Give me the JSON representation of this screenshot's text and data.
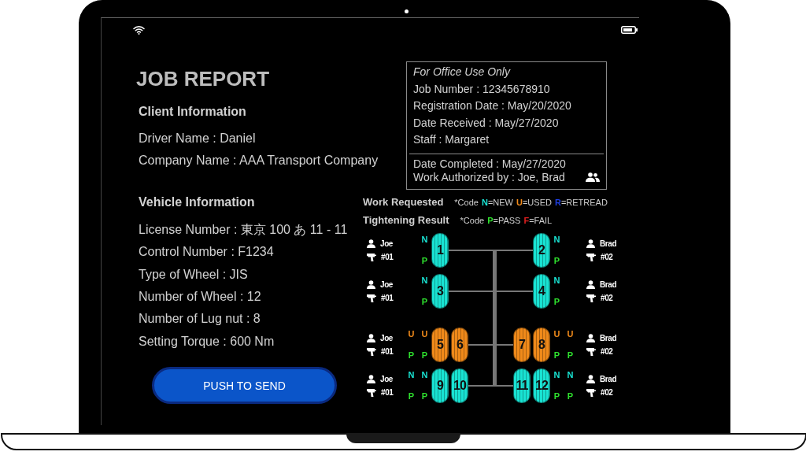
{
  "title": "JOB REPORT",
  "client_information": {
    "heading": "Client Information",
    "fields": [
      "Driver Name : Daniel",
      "Company Name : AAA Transport Company"
    ]
  },
  "vehicle_information": {
    "heading": "Vehicle Information",
    "fields": [
      "License Number : 東京 100 あ 11 - 11",
      "Control Number : F1234",
      "Type of Wheel : JIS",
      "Number of Wheel : 12",
      "Number of Lug nut : 8",
      "Setting Torque : 600 Nm"
    ]
  },
  "send_button": "PUSH TO SEND",
  "office_use": {
    "heading": "For Office Use Only",
    "fields": [
      "Job Number : 12345678910",
      "Registration Date : May/20/2020",
      "Date Received : May/27/2020",
      "Staff : Margaret"
    ],
    "completion_fields": [
      "Date Completed : May/27/2020",
      "Work Authorized by : Joe, Brad"
    ]
  },
  "work_requested": {
    "title": "Work Requested",
    "code_prefix": "*Code",
    "codes": [
      {
        "code": "N",
        "meaning": "=NEW",
        "color": "#19e3d3"
      },
      {
        "code": "U",
        "meaning": "=USED",
        "color": "#f08a1a"
      },
      {
        "code": "R",
        "meaning": "=RETREAD",
        "color": "#1f3fe0"
      }
    ]
  },
  "tightening_result": {
    "title": "Tightening Result",
    "code_prefix": "*Code",
    "codes": [
      {
        "code": "P",
        "meaning": "=PASS",
        "color": "#2ee02e"
      },
      {
        "code": "F",
        "meaning": "=FAIL",
        "color": "#e01f1f"
      }
    ]
  },
  "axles": [
    {
      "left": {
        "operator": "Joe",
        "tool": "#01",
        "wheels": [
          {
            "number": "1",
            "kind": "new",
            "code": "N",
            "result": "P",
            "passed": true
          }
        ]
      },
      "right": {
        "operator": "Brad",
        "tool": "#02",
        "wheels": [
          {
            "number": "2",
            "kind": "new",
            "code": "N",
            "result": "P",
            "passed": true
          }
        ]
      }
    },
    {
      "left": {
        "operator": "Joe",
        "tool": "#01",
        "wheels": [
          {
            "number": "3",
            "kind": "new",
            "code": "N",
            "result": "P",
            "passed": true
          }
        ]
      },
      "right": {
        "operator": "Brad",
        "tool": "#02",
        "wheels": [
          {
            "number": "4",
            "kind": "new",
            "code": "N",
            "result": "P",
            "passed": true
          }
        ]
      }
    },
    {
      "left": {
        "operator": "Joe",
        "tool": "#01",
        "wheels": [
          {
            "number": "5",
            "kind": "used",
            "code": "U",
            "result": "P",
            "passed": true
          },
          {
            "number": "6",
            "kind": "used",
            "code": "U",
            "result": "P",
            "passed": true
          }
        ]
      },
      "right": {
        "operator": "Brad",
        "tool": "#02",
        "wheels": [
          {
            "number": "7",
            "kind": "used",
            "code": "U",
            "result": "P",
            "passed": true
          },
          {
            "number": "8",
            "kind": "used",
            "code": "U",
            "result": "P",
            "passed": true
          }
        ]
      }
    },
    {
      "left": {
        "operator": "Joe",
        "tool": "#01",
        "wheels": [
          {
            "number": "9",
            "kind": "new",
            "code": "N",
            "result": "P",
            "passed": true
          },
          {
            "number": "10",
            "kind": "new",
            "code": "N",
            "result": "P",
            "passed": true
          }
        ]
      },
      "right": {
        "operator": "Brad",
        "tool": "#02",
        "wheels": [
          {
            "number": "11",
            "kind": "new",
            "code": "N",
            "result": "P",
            "passed": true
          },
          {
            "number": "12",
            "kind": "new",
            "code": "N",
            "result": "P",
            "passed": true
          }
        ]
      }
    }
  ]
}
